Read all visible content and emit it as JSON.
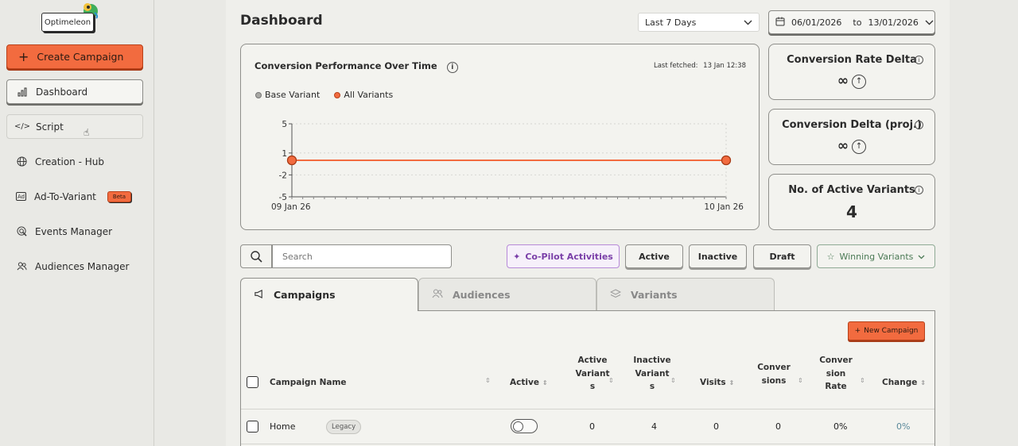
{
  "brand": {
    "logo_text": "Optimeleon"
  },
  "sidebar": {
    "create_label": "Create Campaign",
    "items": [
      {
        "label": "Dashboard",
        "icon": "bar-chart-icon"
      },
      {
        "label": "Script",
        "icon": "code-icon"
      },
      {
        "label": "Creation - Hub",
        "icon": "globe-icon"
      },
      {
        "label": "Ad-To-Variant",
        "icon": "ad-icon",
        "badge": "Beta"
      },
      {
        "label": "Events Manager",
        "icon": "events-icon"
      },
      {
        "label": "Audiences Manager",
        "icon": "users-icon"
      }
    ]
  },
  "header": {
    "title": "Dashboard",
    "period": "Last 7 Days",
    "date_from": "06/01/2026",
    "date_to_label": "to",
    "date_to": "13/01/2026"
  },
  "chart_card": {
    "title": "Conversion Performance Over Time",
    "last_fetched_label": "Last fetched:",
    "last_fetched_value": "13 Jan 12:38"
  },
  "chart_data": {
    "type": "line",
    "x": [
      "09 Jan 26",
      "10 Jan 26"
    ],
    "series": [
      {
        "name": "Base Variant",
        "values": [
          0,
          0
        ],
        "color": "#a8a8a4"
      },
      {
        "name": "All Variants",
        "values": [
          0,
          0
        ],
        "color": "#f26b3f"
      }
    ],
    "yticks": [
      5,
      1,
      -2,
      -5
    ],
    "ylim": [
      -5,
      5
    ],
    "grid": true,
    "legend": "top-left"
  },
  "stats": [
    {
      "label": "Conversion Rate Delta",
      "value": "∞"
    },
    {
      "label": "Conversion Delta (proj.)",
      "value": "∞"
    },
    {
      "label": "No. of Active Variants",
      "value": "4"
    }
  ],
  "filters": {
    "search_placeholder": "Search",
    "copilot": "Co-Pilot Activities",
    "active": "Active",
    "inactive": "Inactive",
    "draft": "Draft",
    "winning": "Winning Variants"
  },
  "tabs": [
    "Campaigns",
    "Audiences",
    "Variants"
  ],
  "table": {
    "new_campaign": "New Campaign",
    "columns": [
      "Campaign Name",
      "Active",
      "Active\nVariant\ns",
      "Inactive\nVariant\ns",
      "Visits",
      "Conver\nsions",
      "Conver\nsion\nRate",
      "Change"
    ],
    "rows": [
      {
        "name": "Home",
        "tag": "Legacy",
        "active": false,
        "active_variants": "0",
        "inactive_variants": "4",
        "visits": "0",
        "conversions": "0",
        "conversion_rate": "0%",
        "change": "0%"
      }
    ]
  }
}
